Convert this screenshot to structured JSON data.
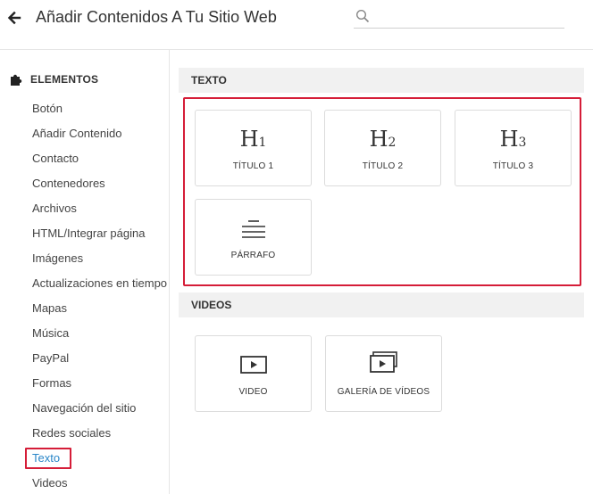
{
  "header": {
    "title": "Añadir Contenidos A Tu Sitio Web",
    "search_placeholder": "",
    "back_icon": "arrow-left-icon",
    "search_icon": "search-icon"
  },
  "sidebar": {
    "heading": "ELEMENTOS",
    "heading_icon": "puzzle-icon",
    "items": [
      {
        "label": "Botón"
      },
      {
        "label": "Añadir Contenido"
      },
      {
        "label": "Contacto"
      },
      {
        "label": "Contenedores"
      },
      {
        "label": "Archivos"
      },
      {
        "label": "HTML/Integrar página"
      },
      {
        "label": "Imágenes"
      },
      {
        "label": "Actualizaciones en tiempo"
      },
      {
        "label": "Mapas"
      },
      {
        "label": "Música"
      },
      {
        "label": "PayPal"
      },
      {
        "label": "Formas"
      },
      {
        "label": "Navegación del sitio"
      },
      {
        "label": "Redes sociales"
      },
      {
        "label": "Texto"
      },
      {
        "label": "Videos"
      }
    ],
    "active_item": "Texto"
  },
  "sections": {
    "texto": {
      "title": "TEXTO",
      "tiles": [
        {
          "glyph_main": "H",
          "glyph_sub": "1",
          "label": "TÍTULO 1"
        },
        {
          "glyph_main": "H",
          "glyph_sub": "2",
          "label": "TÍTULO 2"
        },
        {
          "glyph_main": "H",
          "glyph_sub": "3",
          "label": "TÍTULO 3"
        },
        {
          "icon": "paragraph-lines-icon",
          "label": "PÁRRAFO"
        }
      ]
    },
    "videos": {
      "title": "VIDEOS",
      "tiles": [
        {
          "icon": "video-play-icon",
          "label": "VIDEO"
        },
        {
          "icon": "video-gallery-icon",
          "label": "GALERÍA DE VÍDEOS"
        }
      ]
    }
  },
  "colors": {
    "accent_blue": "#2a86c8",
    "highlight_red": "#d51d38",
    "section_bg": "#f1f1f1",
    "border": "#dcdcdc"
  }
}
